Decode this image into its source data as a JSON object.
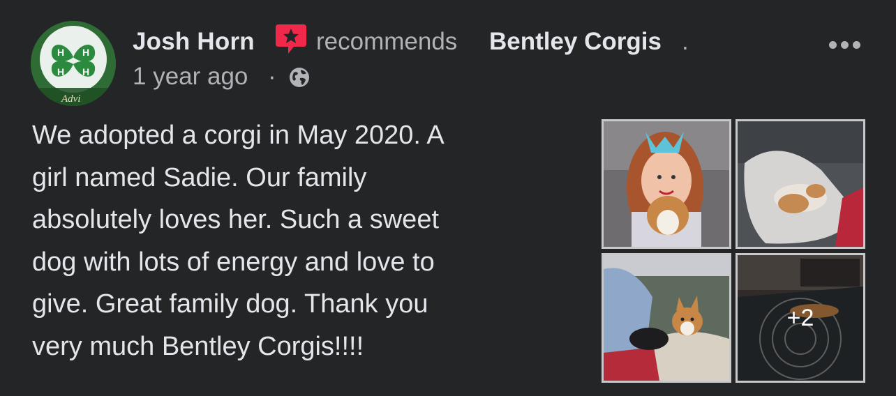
{
  "post": {
    "author": "Josh Horn",
    "action": "recommends",
    "page": "Bentley Corgis",
    "period": ".",
    "time": "1 year ago",
    "separator": "·",
    "privacy_icon": "globe-icon",
    "lines": [
      "We adopted a corgi in May 2020. A",
      "girl named Sadie. Our family",
      "absolutely loves her. Such a sweet",
      "dog with lots of energy and love to",
      "give. Great family dog. Thank you",
      "very much Bentley Corgis!!!!"
    ]
  },
  "avatar": {
    "text": "Advi"
  },
  "photos": {
    "more_count": "+2"
  },
  "colors": {
    "background": "#242526",
    "primary_text": "#e4e6eb",
    "secondary_text": "#b0b3b8",
    "recommend_icon": "#f02849"
  }
}
